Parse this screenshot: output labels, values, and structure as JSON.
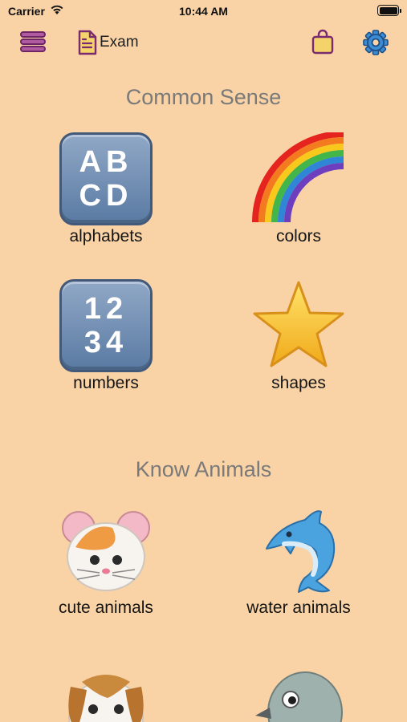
{
  "status_bar": {
    "carrier": "Carrier",
    "time": "10:44 AM"
  },
  "nav": {
    "exam_label": "Exam"
  },
  "sections": [
    {
      "title": "Common Sense",
      "items": [
        {
          "label": "alphabets",
          "keycap_top": "AB",
          "keycap_bottom": "CD"
        },
        {
          "label": "colors"
        },
        {
          "label": "numbers",
          "keycap_top": "12",
          "keycap_bottom": "34"
        },
        {
          "label": "shapes"
        }
      ]
    },
    {
      "title": "Know Animals",
      "items": [
        {
          "label": "cute animals"
        },
        {
          "label": "water animals"
        }
      ]
    }
  ],
  "colors": {
    "background": "#f9d3a6",
    "accent_purple": "#7a2a6e",
    "section_title": "#7a7a7a"
  }
}
